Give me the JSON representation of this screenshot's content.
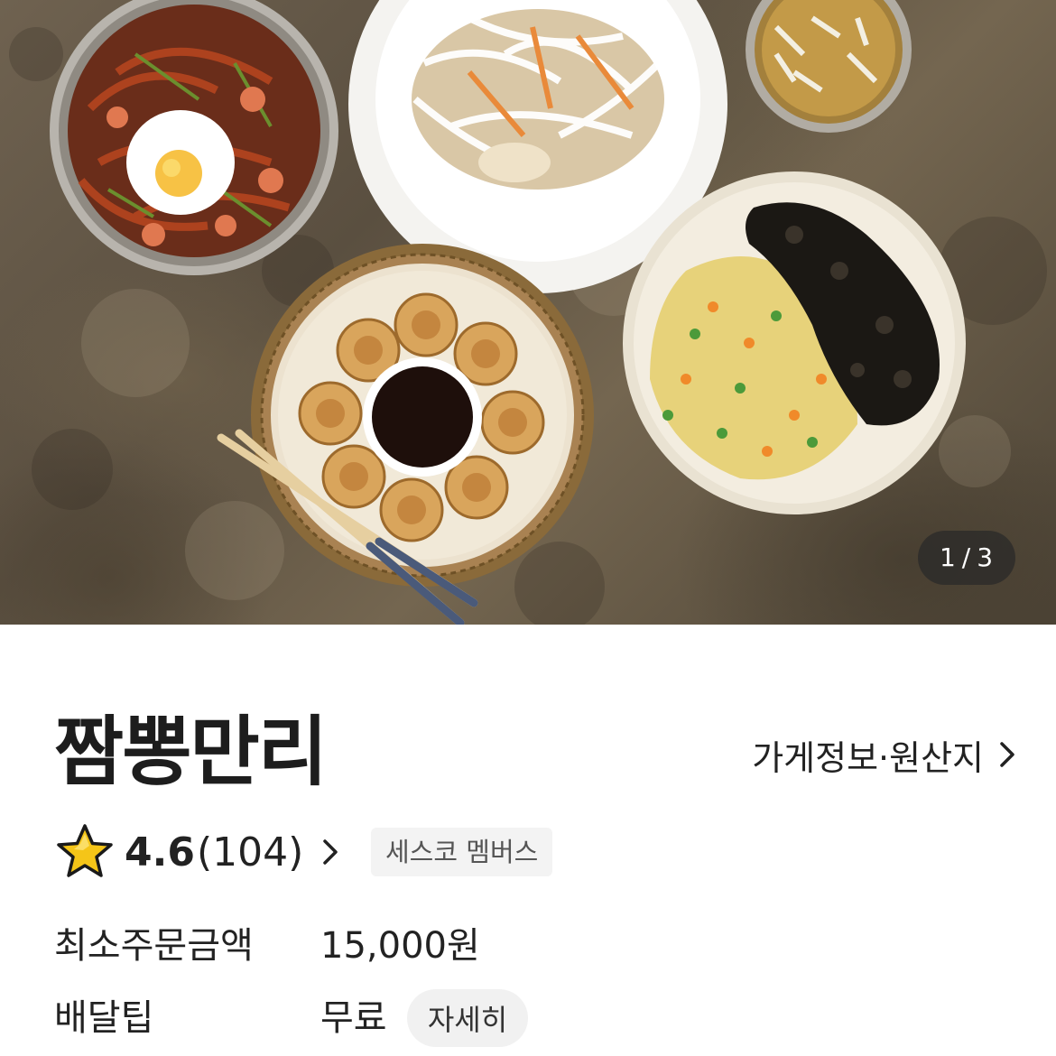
{
  "hero": {
    "counter_current": "1",
    "counter_separator": "/",
    "counter_total": "3"
  },
  "store": {
    "name": "짬뽕만리",
    "info_link_label": "가게정보·원산지",
    "rating": "4.6",
    "review_count": "(104)",
    "badge": "세스코 멤버스",
    "star_color": "#f5c518"
  },
  "info": {
    "min_order_label": "최소주문금액",
    "min_order_value": "15,000원",
    "delivery_tip_label": "배달팁",
    "delivery_tip_value": "무료",
    "detail_button_label": "자세히"
  }
}
